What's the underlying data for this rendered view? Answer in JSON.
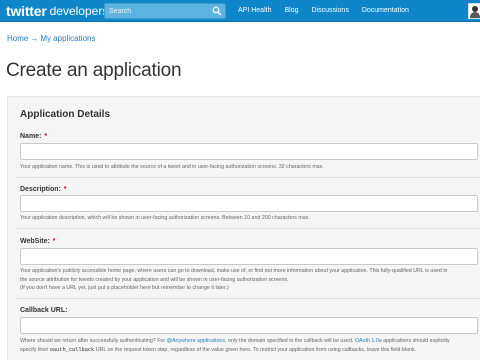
{
  "header": {
    "logo_brand": "twitter",
    "logo_sub": "developers",
    "search_placeholder": "Search",
    "search_icon": "search-icon",
    "nav": [
      "API Health",
      "Blog",
      "Discussions",
      "Documentation"
    ],
    "accent_color": "#0e86c9"
  },
  "breadcrumb": {
    "home": "Home",
    "separator": "→",
    "current": "My applications"
  },
  "page_title": "Create an application",
  "form": {
    "section_title": "Application Details",
    "required_marker": "*",
    "name": {
      "label": "Name:",
      "value": "",
      "help": "Your application name. This is used to attribute the source of a tweet and in user-facing authorization screens. 32 characters max."
    },
    "description": {
      "label": "Description:",
      "value": "",
      "help": "Your application description, which will be shown in user-facing authorization screens. Between 10 and 200 characters max."
    },
    "website": {
      "label": "WebSite:",
      "value": "",
      "help_line1": "Your application's publicly accessible home page, where users can go to download, make use of, or find out more information about your application. This fully-qualified URL is used in",
      "help_line2": "the source attribution for tweets created by your application and will be shown in user-facing authorization screens.",
      "help_line3": "(If you don't have a URL yet, just put a placeholder here but remember to change it later.)"
    },
    "callback": {
      "label": "Callback URL:",
      "value": "",
      "help_a": "Where should we return after successfully authenticating? For ",
      "help_link1": "@Anywhere applications",
      "help_b": ", only the domain specified in the callback will be used. ",
      "help_link2": "OAuth 1.0a",
      "help_c": " applications should explicitly",
      "help2_a": "specify their ",
      "help2_code": "oauth_callback",
      "help2_b": " URL on the request token step, regardless of the value given here. To restrict your application from using callbacks, leave this field blank."
    }
  }
}
